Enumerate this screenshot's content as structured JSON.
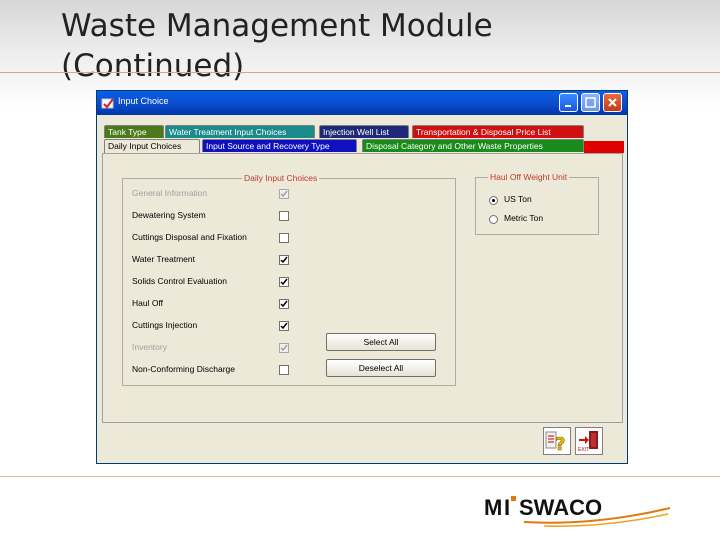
{
  "slide": {
    "title": "Waste Management Module\n(Continued)"
  },
  "window": {
    "title": "Input Choice",
    "colors": {
      "titlebar": "#0a49c8",
      "face": "#ece9d8"
    }
  },
  "tabs": {
    "row1": [
      {
        "label": "Tank Type",
        "bg": "#4a7a1a",
        "fg": "#ffffff"
      },
      {
        "label": "Water Treatment Input Choices",
        "bg": "#1a8a8a",
        "fg": "#ffffff"
      },
      {
        "label": "Injection Well List",
        "bg": "#1e2a78",
        "fg": "#ffffff"
      },
      {
        "label": "Transportation & Disposal Price List",
        "bg": "#d01010",
        "fg": "#ffffff"
      }
    ],
    "row2": [
      {
        "label": "Daily Input Choices",
        "bg": "#ece9d8",
        "fg": "#000000",
        "active": true
      },
      {
        "label": "Input Source and Recovery Type",
        "bg": "#1010c0",
        "fg": "#ffffff"
      },
      {
        "label": "Disposal Category and Other Waste Properties",
        "bg": "#1a8a1a",
        "fg": "#ffffff"
      }
    ]
  },
  "daily_group": {
    "legend": "Daily Input Choices",
    "items": [
      {
        "label": "General Information",
        "checked": true,
        "disabled": true
      },
      {
        "label": "Dewatering System",
        "checked": false,
        "disabled": false
      },
      {
        "label": "Cuttings Disposal and Fixation",
        "checked": false,
        "disabled": false
      },
      {
        "label": "Water Treatment",
        "checked": true,
        "disabled": false
      },
      {
        "label": "Solids Control Evaluation",
        "checked": true,
        "disabled": false
      },
      {
        "label": "Haul Off",
        "checked": true,
        "disabled": false
      },
      {
        "label": "Cuttings Injection",
        "checked": true,
        "disabled": false
      },
      {
        "label": "Inventory",
        "checked": true,
        "disabled": true
      },
      {
        "label": "Non-Conforming Discharge",
        "checked": false,
        "disabled": false
      }
    ],
    "select_all": "Select All",
    "deselect_all": "Deselect All"
  },
  "haul_group": {
    "legend": "Haul Off Weight Unit",
    "options": [
      {
        "label": "US Ton",
        "selected": true
      },
      {
        "label": "Metric Ton",
        "selected": false
      }
    ]
  },
  "bottom_icons": [
    "help-icon",
    "exit-icon"
  ],
  "exit_label": "EXIT",
  "logo": {
    "text": "MI SWACO"
  }
}
